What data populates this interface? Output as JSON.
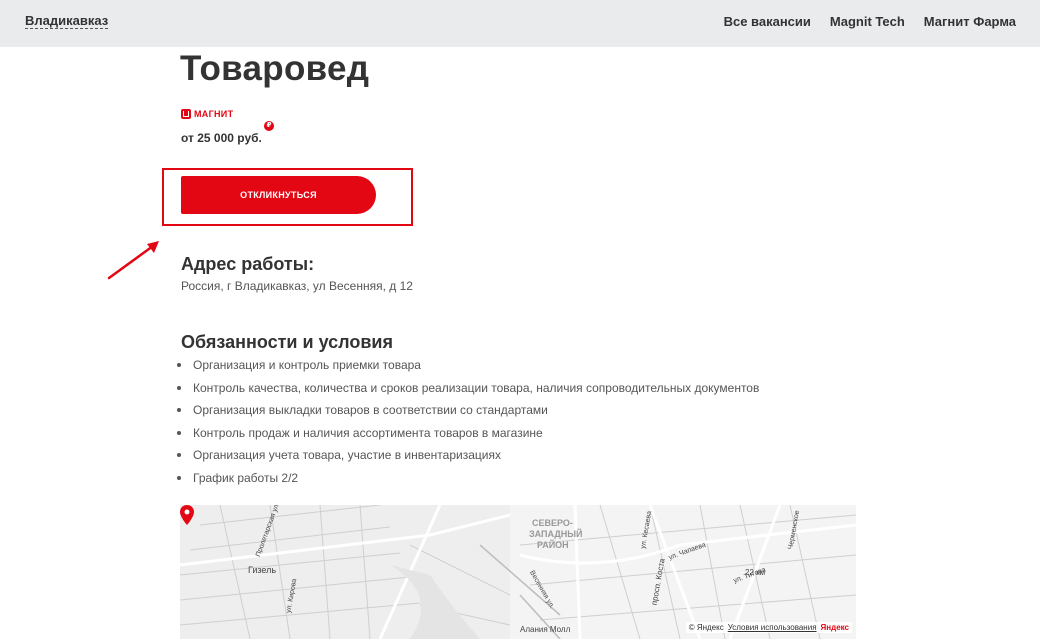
{
  "header": {
    "city": "Владикавказ",
    "nav": [
      "Все вакансии",
      "Magnit Tech",
      "Магнит Фарма"
    ]
  },
  "vacancy": {
    "title": "Товаровед",
    "brand": "МАГНИТ",
    "salary": "от 25 000 руб.",
    "ruble_badge": "₽",
    "apply_label": "ОТКЛИКНУТЬСЯ"
  },
  "address": {
    "heading": "Адрес работы:",
    "text": "Россия, г Владикавказ, ул Весенняя, д 12"
  },
  "duties": {
    "heading": "Обязанности и условия",
    "items": [
      "Организация и контроль приемки товара",
      "Контроль качества, количества и сроков реализации товара, наличия сопроводительных документов",
      "Организация выкладки товаров в соответствии со стандартами",
      "Контроль продаж и наличия ассортимента товаров в магазине",
      "Организация учета товара, участие в инвентаризациях",
      "График работы 2/2"
    ]
  },
  "map": {
    "labels": {
      "district1": "СЕВЕРО-",
      "district2": "ЗАПАДНЫЙ",
      "district3": "РАЙОН",
      "gizel": "Гизель",
      "proletarskaya": "Пролетарская ул.",
      "kirova": "ул. Кирова",
      "vesennyaya": "Весенняя ул.",
      "chapaeva": "ул. Чапаева",
      "titova": "ул. Титова",
      "kosta": "просп. Коста",
      "km22": "22 км",
      "alania": "Алания Молл",
      "kesaeva": "ул. Кесаева",
      "chermen": "Черменское"
    },
    "copyright": "© Яндекс",
    "terms": "Условия использования",
    "logo": "Яндекс"
  },
  "colors": {
    "accent": "#e30613",
    "header_bg": "#eaebed",
    "text": "#333333"
  }
}
